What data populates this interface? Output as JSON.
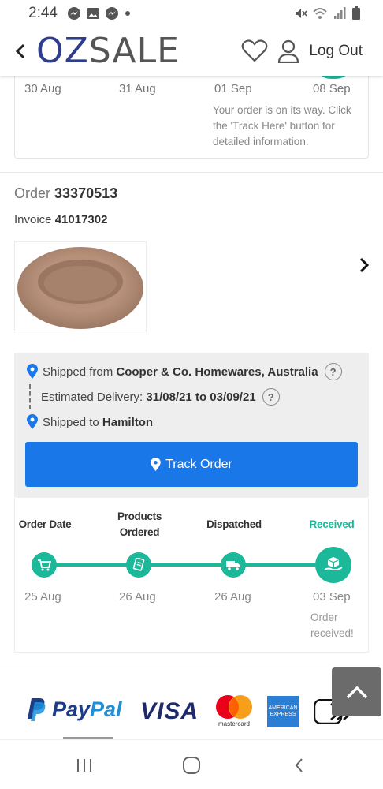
{
  "status_bar": {
    "time": "2:44",
    "icons": [
      "messenger-icon",
      "gallery-icon",
      "messenger-icon",
      "dot-icon",
      "mute-icon",
      "wifi-icon",
      "signal-icon",
      "battery-icon"
    ]
  },
  "header": {
    "logo_oz": "OZ",
    "logo_sale": "SALE",
    "logout_label": "Log Out"
  },
  "previous_order": {
    "dates": [
      "30 Aug",
      "31 Aug",
      "01 Sep",
      "08 Sep"
    ],
    "note": "Your order is on its way. Click the 'Track Here' button for detailed information."
  },
  "order": {
    "order_label": "Order",
    "order_number": "33370513",
    "invoice_label": "Invoice",
    "invoice_number": "41017302"
  },
  "shipping": {
    "from_label": "Shipped from",
    "from_value": "Cooper & Co. Homewares, Australia",
    "delivery_label": "Estimated Delivery:",
    "delivery_value": "31/08/21 to 03/09/21",
    "to_label": "Shipped to",
    "to_value": "Hamilton",
    "help_symbol": "?"
  },
  "track_button": {
    "label": "Track Order"
  },
  "progress": {
    "steps": [
      {
        "label": "Order Date",
        "date": "25 Aug",
        "icon": "cart-icon"
      },
      {
        "label": "Products Ordered",
        "date": "26 Aug",
        "icon": "document-icon"
      },
      {
        "label": "Dispatched",
        "date": "26 Aug",
        "icon": "truck-icon"
      },
      {
        "label": "Received",
        "date": "03 Sep",
        "icon": "package-hand-icon"
      }
    ],
    "received_note": "Order received!",
    "active_color": "#1bb89a"
  },
  "payments": {
    "paypal_pay": "Pay",
    "paypal_pal": "Pal",
    "visa": "VISA",
    "mastercard": "mastercard",
    "amex": "AMERICAN EXPRESS"
  },
  "colors": {
    "brand_blue": "#2f3e8c",
    "track_button": "#1a77e8",
    "teal": "#1bb89a"
  }
}
